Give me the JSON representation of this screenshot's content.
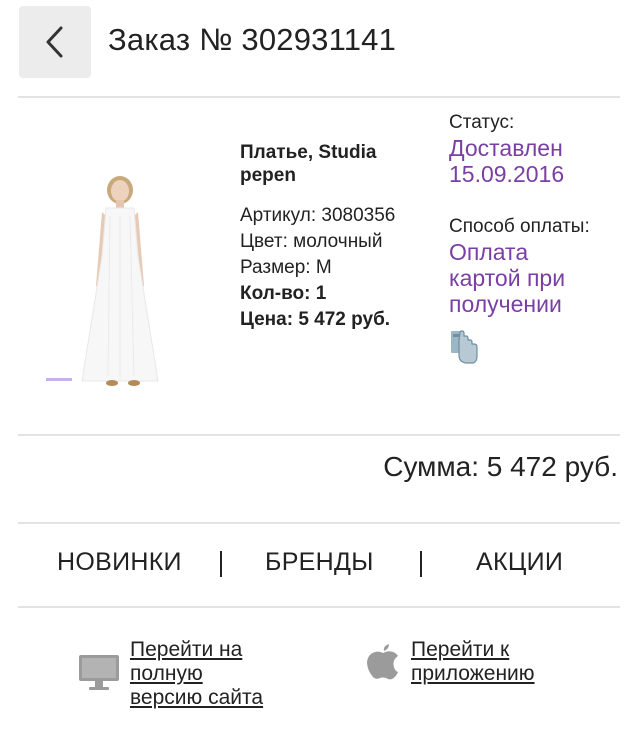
{
  "header": {
    "back_icon": "chevron-left-icon",
    "title": "Заказ № 302931141"
  },
  "product": {
    "image_alt": "white maxi dress",
    "name": "Платье, Studia pepen",
    "article": "Артикул: 3080356",
    "color": "Цвет: молочный",
    "size": "Размер: M",
    "quantity": "Кол-во: 1",
    "price": "Цена: 5 472 руб."
  },
  "status": {
    "label": "Статус:",
    "value_line1": "Доставлен",
    "value_line2": "15.09.2016"
  },
  "payment": {
    "label": "Способ оплаты:",
    "line1": "Оплата",
    "line2": "картой при",
    "line3": "получении",
    "icon": "hand-card-icon"
  },
  "summary": {
    "total": "Сумма: 5 472 руб."
  },
  "nav": {
    "new": "НОВИНКИ",
    "brands": "БРЕНДЫ",
    "sales": "АКЦИИ",
    "separator": "|"
  },
  "footer": {
    "desktop_line1": "Перейти на",
    "desktop_line2": "полную",
    "desktop_line3": "версию сайта",
    "app_line1": "Перейти к",
    "app_line2": "приложению",
    "desktop_icon": "monitor-icon",
    "app_icon": "apple-icon"
  },
  "colors": {
    "accent": "#7a3fa5",
    "divider": "#e3e3e3",
    "back_button_bg": "#ececec"
  }
}
